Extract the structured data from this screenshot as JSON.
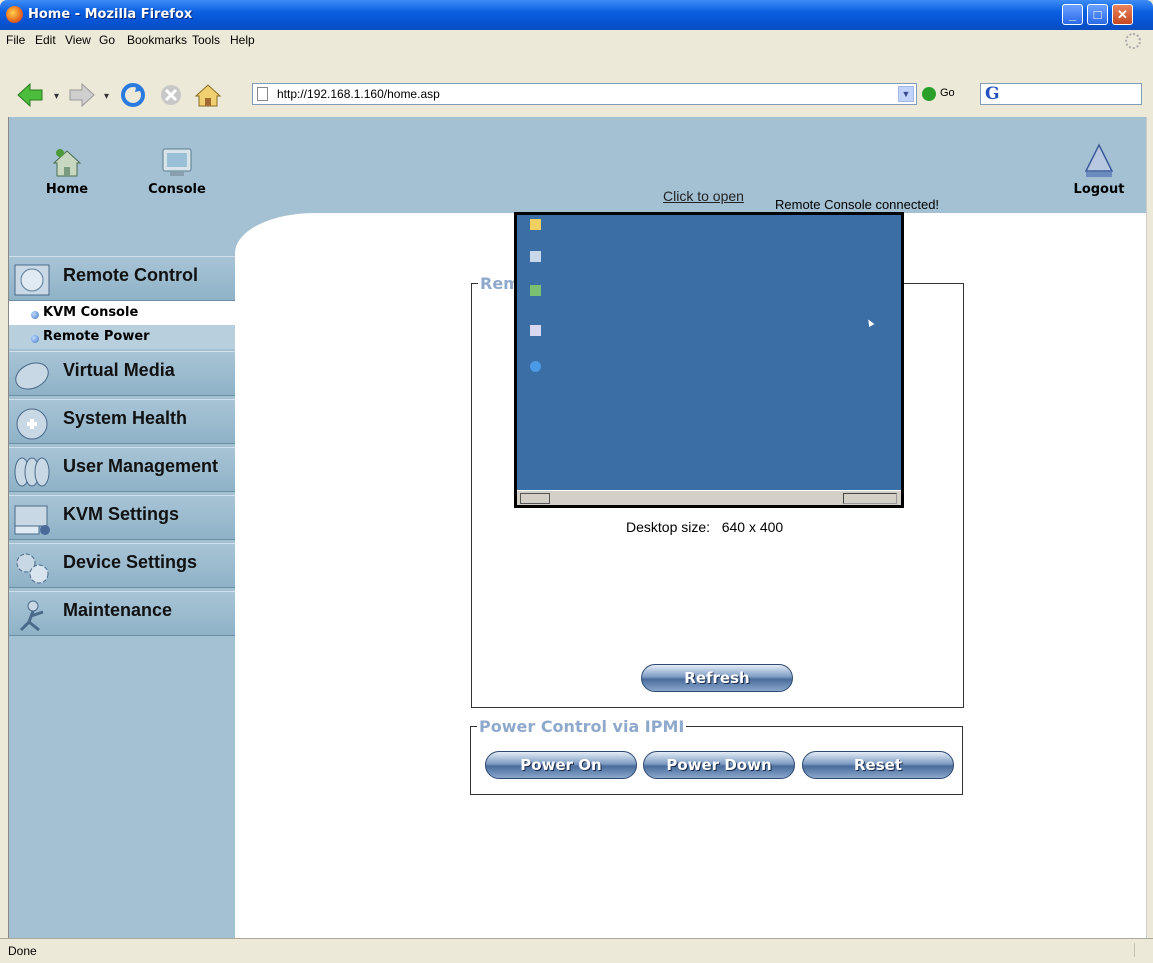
{
  "window": {
    "title": "Home - Mozilla Firefox"
  },
  "menubar": [
    "File",
    "Edit",
    "View",
    "Go",
    "Bookmarks",
    "Tools",
    "Help"
  ],
  "toolbar": {
    "url": "http://192.168.1.160/home.asp",
    "go_label": "Go",
    "search_logo": "G"
  },
  "top_nav": {
    "home_label": "Home",
    "console_label": "Console",
    "logout_label": "Logout",
    "status": "Remote Console connected!"
  },
  "sidebar": {
    "sections": [
      {
        "label": "Remote Control",
        "icon": "remote-control-icon"
      },
      {
        "label": "Virtual Media",
        "icon": "virtual-media-icon"
      },
      {
        "label": "System Health",
        "icon": "system-health-icon"
      },
      {
        "label": "User Management",
        "icon": "user-management-icon"
      },
      {
        "label": "KVM Settings",
        "icon": "kvm-settings-icon"
      },
      {
        "label": "Device Settings",
        "icon": "device-settings-icon"
      },
      {
        "label": "Maintenance",
        "icon": "maintenance-icon"
      }
    ],
    "subitems": [
      {
        "label": "KVM Console",
        "active": true
      },
      {
        "label": "Remote Power",
        "active": false
      }
    ]
  },
  "preview_panel": {
    "legend": "Remote Console Preview",
    "click_to_open": "Click to open",
    "desktop_size_label": "Desktop size:",
    "desktop_size_value": "640 x 400",
    "refresh_label": "Refresh"
  },
  "power_panel": {
    "legend": "Power Control via IPMI",
    "power_on_label": "Power On",
    "power_down_label": "Power Down",
    "reset_label": "Reset"
  },
  "statusbar": {
    "text": "Done"
  },
  "colors": {
    "band": "#a3c1d3",
    "legend": "#8fa9cc",
    "desktop": "#3a6ea5"
  }
}
